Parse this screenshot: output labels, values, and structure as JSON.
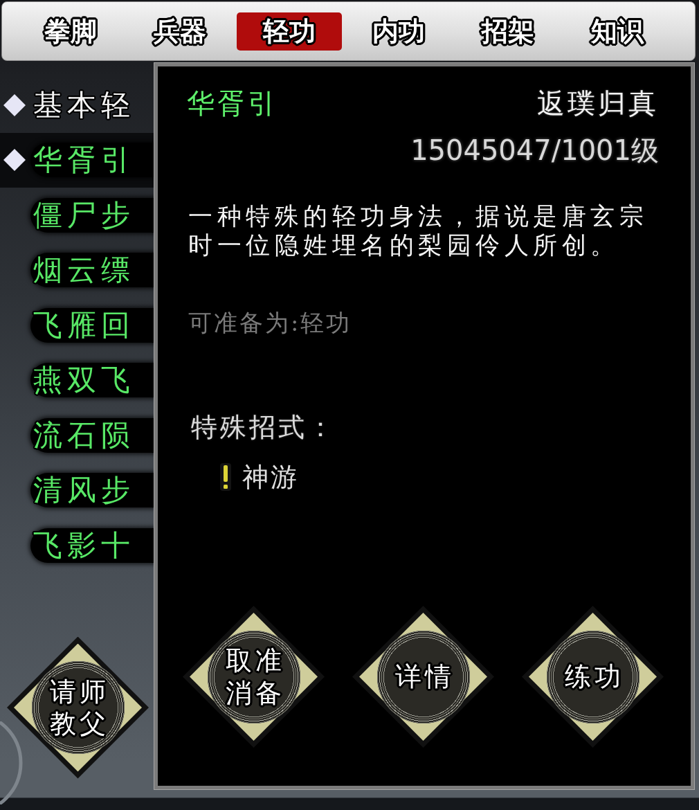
{
  "tabs": [
    {
      "label": "拳脚",
      "selected": false
    },
    {
      "label": "兵器",
      "selected": false
    },
    {
      "label": "轻功",
      "selected": true
    },
    {
      "label": "内功",
      "selected": false
    },
    {
      "label": "招架",
      "selected": false
    },
    {
      "label": "知识",
      "selected": false
    }
  ],
  "skills": [
    {
      "name": "基本轻",
      "kind": "basic",
      "prepared": true,
      "selected": false
    },
    {
      "name": "华胥引",
      "kind": "special",
      "prepared": true,
      "selected": true
    },
    {
      "name": "僵尸步",
      "kind": "special",
      "prepared": false,
      "selected": false
    },
    {
      "name": "烟云缥",
      "kind": "special",
      "prepared": false,
      "selected": false
    },
    {
      "name": "飞雁回",
      "kind": "special",
      "prepared": false,
      "selected": false
    },
    {
      "name": "燕双飞",
      "kind": "special",
      "prepared": false,
      "selected": false
    },
    {
      "name": "流石陨",
      "kind": "special",
      "prepared": false,
      "selected": false
    },
    {
      "name": "清风步",
      "kind": "special",
      "prepared": false,
      "selected": false
    },
    {
      "name": "飞影十",
      "kind": "special",
      "prepared": false,
      "selected": false
    }
  ],
  "master_button": {
    "label": "请教师父"
  },
  "detail": {
    "name": "华胥引",
    "rank": "返璞归真",
    "level": "15045047/1001级",
    "description": "一种特殊的轻功身法，据说是唐玄宗时一位隐姓埋名的梨园伶人所创。",
    "usable_as": "可准备为:轻功",
    "special_moves_title": "特殊招式：",
    "special_moves": [
      {
        "name": "神游"
      }
    ],
    "buttons": [
      {
        "label": "取消准备"
      },
      {
        "label": "详情"
      },
      {
        "label": "练功"
      }
    ]
  }
}
